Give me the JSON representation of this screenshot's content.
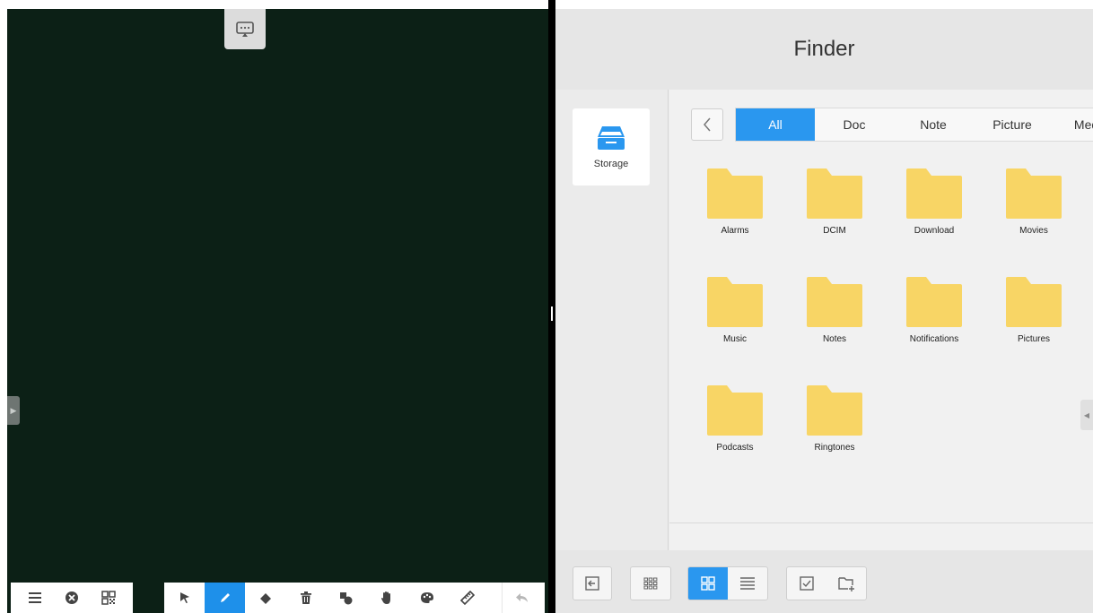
{
  "whiteboard": {
    "left_toolbar": [
      {
        "icon": "menu-icon"
      },
      {
        "icon": "close-circle-icon"
      },
      {
        "icon": "qr-code-icon"
      }
    ],
    "tools": [
      {
        "icon": "select-arrow-icon",
        "active": false
      },
      {
        "icon": "pen-icon",
        "active": true
      },
      {
        "icon": "eraser-icon",
        "active": false
      },
      {
        "icon": "trash-icon",
        "active": false
      },
      {
        "icon": "shapes-icon",
        "active": false
      },
      {
        "icon": "hand-icon",
        "active": false
      },
      {
        "icon": "palette-icon",
        "active": false
      },
      {
        "icon": "ruler-icon",
        "active": false
      },
      {
        "icon": "undo-icon",
        "active": false
      }
    ]
  },
  "finder": {
    "title": "Finder",
    "storage_label": "Storage",
    "tabs": [
      "All",
      "Doc",
      "Note",
      "Picture",
      "Media"
    ],
    "active_tab": "All",
    "folders": [
      "Alarms",
      "DCIM",
      "Download",
      "Movies",
      "Music",
      "Notes",
      "Notifications",
      "Pictures",
      "Podcasts",
      "Ringtones"
    ]
  },
  "colors": {
    "accent": "#2a97ef",
    "board_bg": "#0c2016",
    "folder": "#f8d565"
  }
}
